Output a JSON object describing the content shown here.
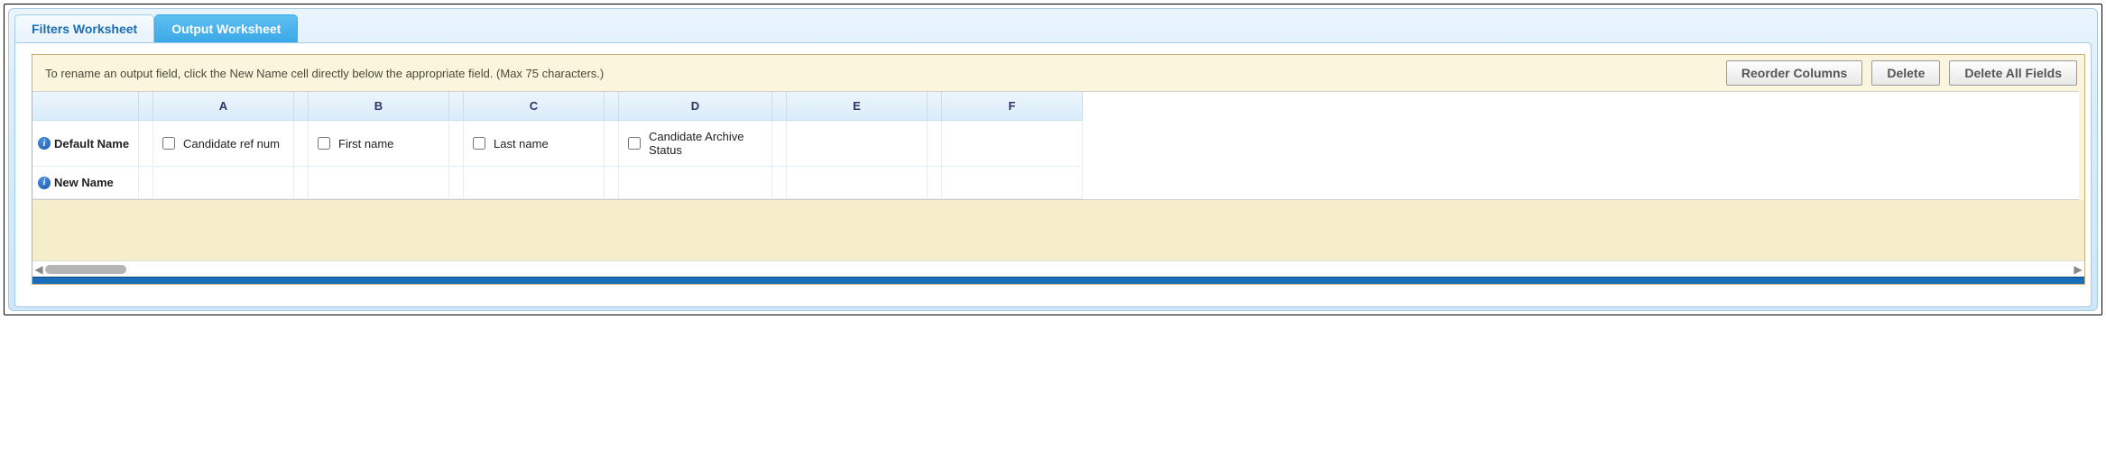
{
  "tabs": {
    "filters": "Filters Worksheet",
    "output": "Output Worksheet"
  },
  "toolbar": {
    "instruction": "To rename an output field, click the New Name cell directly below the appropriate field. (Max 75 characters.)",
    "reorder": "Reorder Columns",
    "delete": "Delete",
    "delete_all": "Delete All Fields"
  },
  "columns": [
    "A",
    "B",
    "C",
    "D",
    "E",
    "F"
  ],
  "rows": {
    "default_name_label": "Default Name",
    "new_name_label": "New Name"
  },
  "fields": {
    "A": "Candidate ref num",
    "B": "First name",
    "C": "Last name",
    "D": "Candidate Archive Status",
    "E": "",
    "F": ""
  },
  "info_glyph": "i"
}
